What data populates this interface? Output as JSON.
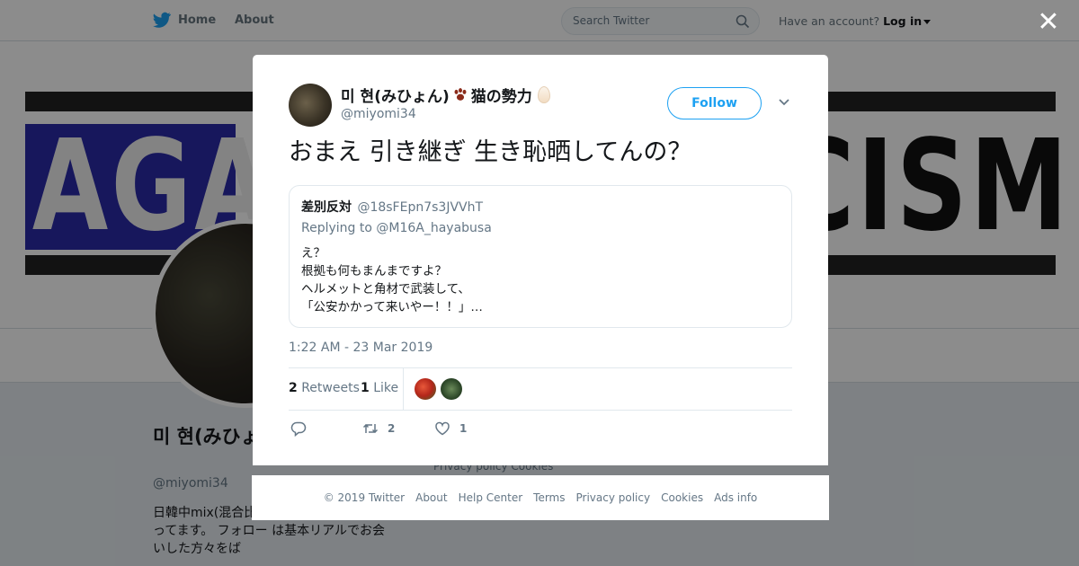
{
  "topbar": {
    "home_label": "Home",
    "about_label": "About",
    "search_placeholder": "Search Twitter",
    "account_prompt": "Have an account?",
    "login_label": "Log in"
  },
  "banner": {
    "left_text": "AGA",
    "right_text": "CISM"
  },
  "profile": {
    "name": "미 현(みひょん)🐾猫の勢力",
    "handle": "@miyomi34",
    "bio": "日韓中mix(混合比... 員w あと色々(黒) やってます。 フォロー は基本リアルでお会いした方々をば",
    "side_links": "Privacy policy   Cookies"
  },
  "tweet": {
    "author_name": "미 현(みひょん)",
    "author_name_suffix": "猫の勢力",
    "author_handle": "@miyomi34",
    "follow_label": "Follow",
    "text": "おまえ 引き継ぎ 生き恥晒してんの？",
    "quote": {
      "name": "差別反対",
      "handle": "@18sFEpn7s3JVVhT",
      "replying_to": "Replying to @M16A_hayabusa",
      "lines": [
        "え？",
        "根拠も何もまんまですよ？",
        "ヘルメットと角材で武装して、",
        "「公安かかって来いやー！！」…"
      ]
    },
    "timestamp": "1:22 AM - 23 Mar 2019",
    "retweets_count": "2",
    "retweets_label": "Retweets",
    "likes_count": "1",
    "likes_label": "Like",
    "action_retweet_count": "2",
    "action_like_count": "1"
  },
  "footer": {
    "links": [
      "© 2019 Twitter",
      "About",
      "Help Center",
      "Terms",
      "Privacy policy",
      "Cookies",
      "Ads info"
    ]
  },
  "colors": {
    "accent": "#1da1f2",
    "banner_blue": "#2a2aa8"
  }
}
